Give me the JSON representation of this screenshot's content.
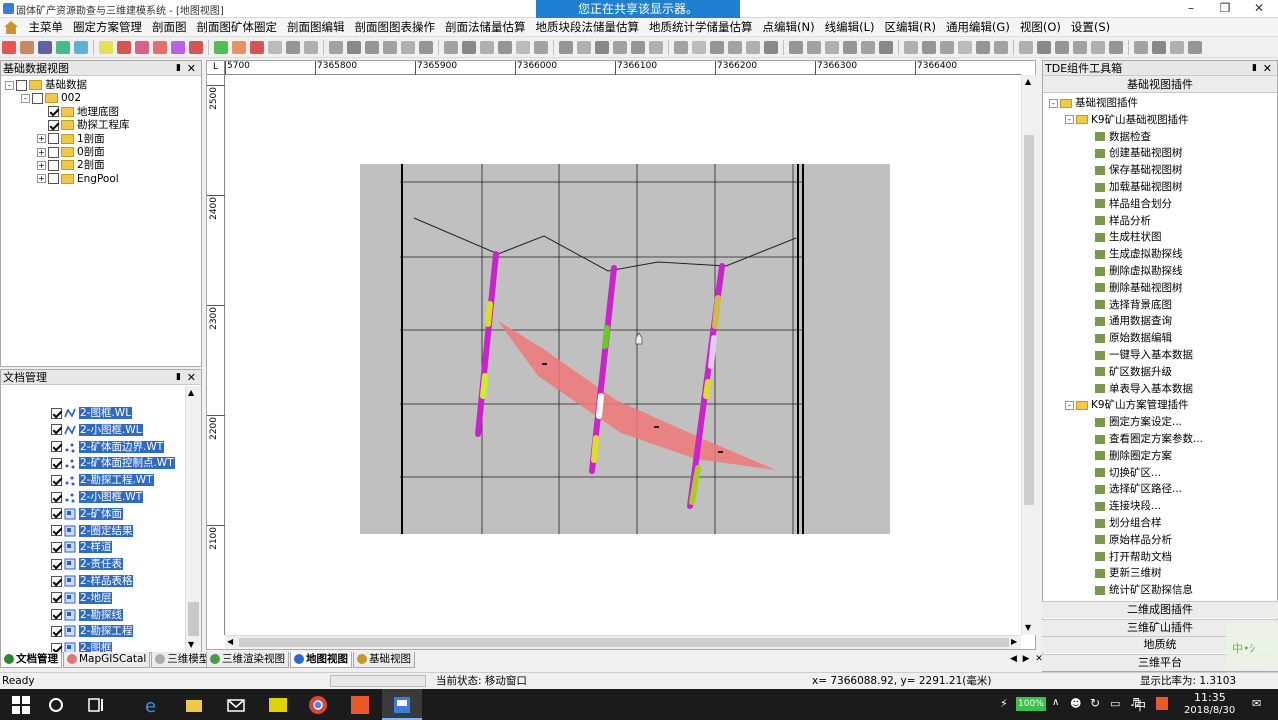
{
  "window": {
    "title": "固体矿产资源勘查与三维建模系统 - [地图视图]",
    "share_banner": "您正在共享该显示器。"
  },
  "menu": {
    "items": [
      "主菜单",
      "圈定方案管理",
      "剖面图",
      "剖面图矿体圈定",
      "剖面图编辑",
      "剖面图图表操作",
      "剖面法储量估算",
      "地质块段法储量估算",
      "地质统计学储量估算",
      "点编辑(N)",
      "线编辑(L)",
      "区编辑(R)",
      "通用编辑(G)",
      "视图(O)",
      "设置(S)"
    ]
  },
  "left_top": {
    "title": "基础数据视图",
    "tree": [
      {
        "label": "基础数据",
        "level": 0,
        "exp": "-",
        "checked": false,
        "folder": true
      },
      {
        "label": "002",
        "level": 1,
        "exp": "-",
        "checked": false,
        "folder": true
      },
      {
        "label": "地理底图",
        "level": 2,
        "exp": "",
        "checked": true,
        "folder": true
      },
      {
        "label": "勘探工程库",
        "level": 2,
        "exp": "",
        "checked": true,
        "folder": true
      },
      {
        "label": "1剖面",
        "level": 2,
        "exp": "+",
        "checked": false,
        "folder": true
      },
      {
        "label": "0剖面",
        "level": 2,
        "exp": "+",
        "checked": false,
        "folder": true
      },
      {
        "label": "2剖面",
        "level": 2,
        "exp": "+",
        "checked": false,
        "folder": true
      },
      {
        "label": "EngPool",
        "level": 2,
        "exp": "+",
        "checked": false,
        "folder": true
      }
    ]
  },
  "left_bottom": {
    "title": "文档管理",
    "layers": [
      {
        "label": "2-图框.WL",
        "type": "line"
      },
      {
        "label": "2-小图框.WL",
        "type": "line"
      },
      {
        "label": "2-矿体面边界.WT",
        "type": "point"
      },
      {
        "label": "2-矿体面控制点.WT",
        "type": "point"
      },
      {
        "label": "2-勘探工程.WT",
        "type": "point"
      },
      {
        "label": "2-小图框.WT",
        "type": "point"
      },
      {
        "label": "2-矿体面",
        "type": "group"
      },
      {
        "label": "2-圈定结果",
        "type": "group"
      },
      {
        "label": "2-样道",
        "type": "group"
      },
      {
        "label": "2-责任表",
        "type": "group"
      },
      {
        "label": "2-样品表格",
        "type": "group"
      },
      {
        "label": "2-地层",
        "type": "group"
      },
      {
        "label": "2-勘探线",
        "type": "group"
      },
      {
        "label": "2-勘探工程",
        "type": "group"
      },
      {
        "label": "2-图框",
        "type": "group"
      },
      {
        "label": "2-小图框",
        "type": "group"
      }
    ]
  },
  "map": {
    "h_ticks": [
      "5700",
      "7365800",
      "7365900",
      "7366000",
      "7366100",
      "7366200",
      "7366300",
      "7366400"
    ],
    "v_ticks": [
      "2500",
      "2400",
      "2300",
      "2200",
      "2100"
    ]
  },
  "right": {
    "title": "TDE组件工具箱",
    "section_header": "基础视图插件",
    "root": "基础视图插件",
    "groups": [
      {
        "label": "K9矿山基础视图插件",
        "items": [
          "数据检查",
          "创建基础视图树",
          "保存基础视图树",
          "加载基础视图树",
          "样品组合划分",
          "样品分析",
          "生成柱状图",
          "生成虚拟勘探线",
          "删除虚拟勘探线",
          "删除基础视图树",
          "选择背景底图",
          "通用数据查询",
          "原始数据编辑",
          "一键导入基本数据",
          "矿区数据升级",
          "单表导入基本数据"
        ]
      },
      {
        "label": "K9矿山方案管理插件",
        "items": [
          "圈定方案设定...",
          "查看圈定方案参数...",
          "删除圈定方案",
          "切换矿区...",
          "选择矿区路径...",
          "连接块段...",
          "划分组合样",
          "原始样品分析",
          "打开帮助文档",
          "更新三维树",
          "统计矿区勘探信息"
        ]
      }
    ],
    "accordion": [
      "二维成图插件",
      "三维矿山插件",
      "地质统",
      "三维平台"
    ]
  },
  "tabs": {
    "left": [
      "文档管理",
      "MapGISCatal",
      "三维模型"
    ],
    "map": [
      "三维渲染视图",
      "地图视图",
      "基础视图"
    ]
  },
  "status": {
    "ready": "Ready",
    "state": "当前状态: 移动窗口",
    "coords": "x= 7366088.92, y= 2291.21(毫米)",
    "scale": "显示比率为:  1.3103"
  },
  "taskbar": {
    "time": "11:35",
    "date": "2018/8/30",
    "battery": "100%",
    "ime": "中"
  }
}
